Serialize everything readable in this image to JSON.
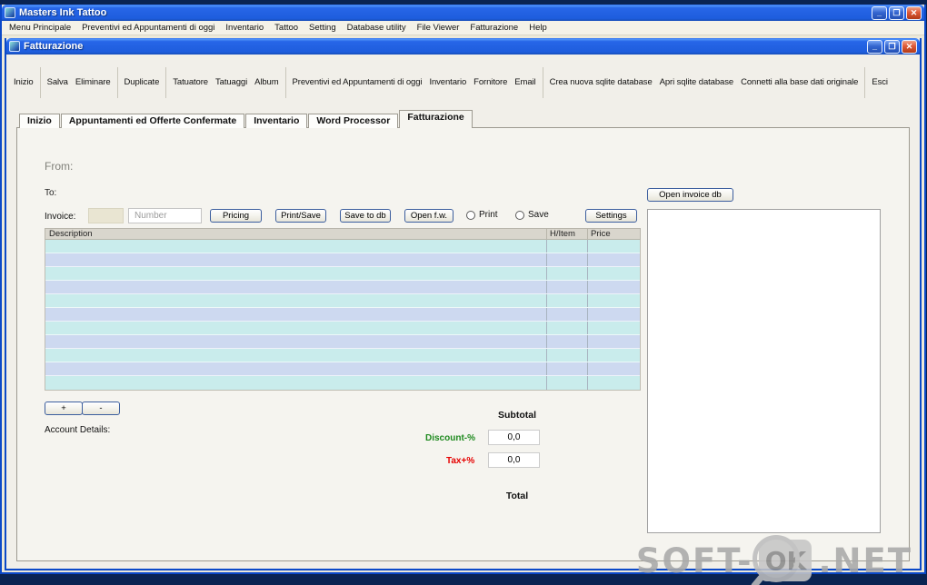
{
  "colors": {
    "discount_green": "#1f8a1f",
    "tax_red": "#e60000",
    "row_cyan": "#c9ecec",
    "row_blue": "#cdd9f0"
  },
  "window_controls": {
    "minimize": "_",
    "maximize": "❐",
    "close": "✕"
  },
  "main_window": {
    "title": "Masters Ink Tattoo"
  },
  "menubar": {
    "items": [
      "Menu Principale",
      "Preventivi ed Appuntamenti di oggi",
      "Inventario",
      "Tattoo",
      "Setting",
      "Database utility",
      "File Viewer",
      "Fatturazione",
      "Help"
    ]
  },
  "child_window": {
    "title": "Fatturazione"
  },
  "toolbar": {
    "items": [
      "Inizio",
      "Salva",
      "Eliminare",
      "Duplicate",
      "Tatuatore",
      "Tatuaggi",
      "Album",
      "Preventivi ed Appuntamenti di oggi",
      "Inventario",
      "Fornitore",
      "Email",
      "Crea nuova sqlite database",
      "Apri sqlite database",
      "Connetti alla base dati originale",
      "Esci"
    ]
  },
  "tabs": {
    "items": [
      "Inizio",
      "Appuntamenti ed Offerte Confermate",
      "Inventario",
      "Word Processor",
      "Fatturazione"
    ],
    "active": "Fatturazione"
  },
  "form": {
    "from_label": "From:",
    "to_label": "To:",
    "invoice_label": "Invoice:",
    "number_placeholder": "Number",
    "pricing_button": "Pricing",
    "print_save_button": "Print/Save",
    "save_to_db_button": "Save to db",
    "open_fw_button": "Open f.w.",
    "print_radio": "Print",
    "save_radio": "Save",
    "settings_button": "Settings",
    "open_invoice_db_button": "Open invoice db",
    "add_row_button": "+",
    "remove_row_button": "-",
    "account_details_label": "Account Details:"
  },
  "table": {
    "headers": [
      "Description",
      "H/Item",
      "Price"
    ]
  },
  "totals": {
    "subtotal_label": "Subtotal",
    "discount_label": "Discount-%",
    "discount_value": "0,0",
    "tax_label": "Tax+%",
    "tax_value": "0,0",
    "total_label": "Total"
  },
  "watermark": {
    "part1": "SOFT-",
    "part2": "OK",
    "part3": ".NET"
  }
}
